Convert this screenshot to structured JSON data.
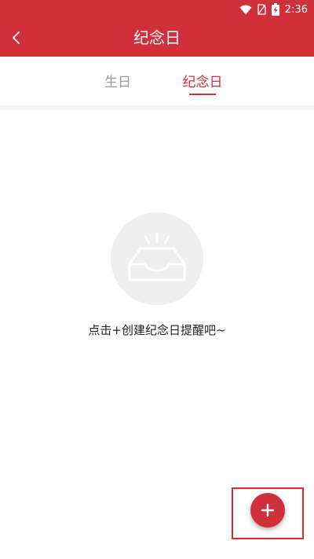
{
  "colors": {
    "brand": "#d0303a"
  },
  "status_bar": {
    "time": "2:36",
    "icons": [
      "wifi-icon",
      "no-sim-icon",
      "battery-charging-icon"
    ]
  },
  "app_bar": {
    "title": "纪念日",
    "back_icon": "chevron-left-icon"
  },
  "tabs": [
    {
      "label": "生日",
      "selected": false
    },
    {
      "label": "纪念日",
      "selected": true
    }
  ],
  "empty_state": {
    "icon": "empty-inbox-icon",
    "message": "点击+创建纪念日提醒吧~"
  },
  "fab": {
    "icon": "plus-icon"
  }
}
